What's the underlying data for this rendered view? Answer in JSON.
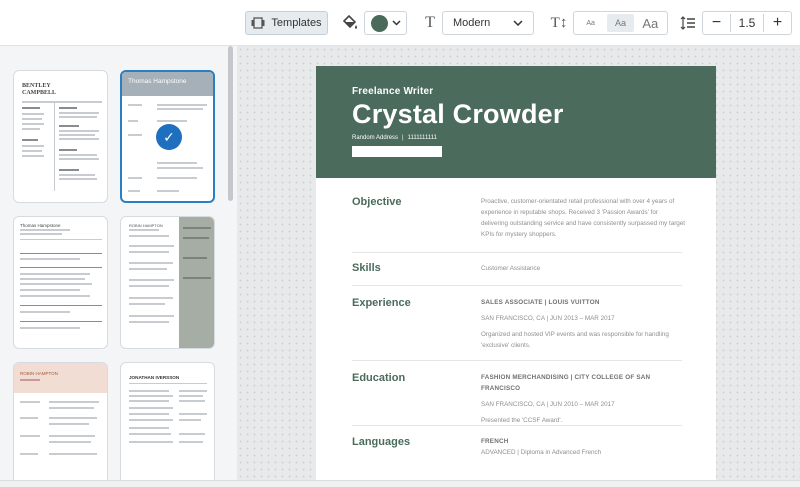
{
  "toolbar": {
    "templates_label": "Templates",
    "accent_color": "#4b6b5c",
    "font_value": "Modern",
    "size_options": [
      "Aa",
      "Aa",
      "Aa"
    ],
    "line_height_value": "1.5",
    "minus_label": "−",
    "plus_label": "+"
  },
  "thumbnails": [
    {
      "name": "BENTLEY CAMPBELL",
      "selected": false
    },
    {
      "name": "Thomas Hampstone",
      "selected": true
    },
    {
      "name": "Thomas Hampstone",
      "selected": false
    },
    {
      "name": "ROBIN HAMPTON",
      "selected": false
    },
    {
      "name": "ROBIN HAMPTON",
      "selected": false
    },
    {
      "name": "JONATHAN IVERSSON",
      "selected": false
    }
  ],
  "resume": {
    "role": "Freelance Writer",
    "name": "Crystal Crowder",
    "address": "Random Address",
    "phone": "1111111111",
    "header_color": "#4b6b5c",
    "sections": {
      "objective": {
        "title": "Objective",
        "text": "Proactive, customer-orientated retail professional with over 4 years of experience in reputable shops. Received 3 'Passion Awards' for delivering outstanding service and have consistently surpassed my target KPIs for mystery shoppers."
      },
      "skills": {
        "title": "Skills",
        "text": "Customer Assistance"
      },
      "experience": {
        "title": "Experience",
        "role": "SALES ASSOCIATE",
        "company": "LOUIS VUITTON",
        "location": "SAN FRANCISCO, CA",
        "start": "JUN 2013",
        "end": "MAR 2017",
        "text": "Organized and hosted VIP events and was responsible for handling 'exclusive' clients."
      },
      "education": {
        "title": "Education",
        "degree": "FASHION MERCHANDISING",
        "school": "CITY COLLEGE OF SAN FRANCISCO",
        "location": "SAN FRANCISCO, CA",
        "start": "JUN 2010",
        "end": "MAR 2017",
        "text": "Presented the 'CCSF Award'."
      },
      "languages": {
        "title": "Languages",
        "language": "FRENCH",
        "level": "ADVANCED",
        "detail": "Diploma in Advanced French"
      }
    }
  }
}
